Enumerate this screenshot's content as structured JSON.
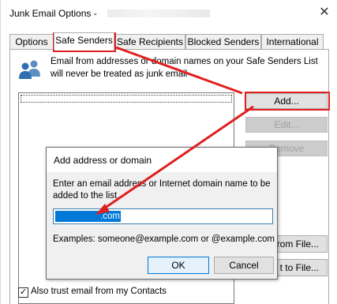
{
  "window": {
    "title": "Junk Email Options - ",
    "close_glyph": "✕"
  },
  "tabs": [
    {
      "label": "Options"
    },
    {
      "label": "Safe Senders"
    },
    {
      "label": "Safe Recipients"
    },
    {
      "label": "Blocked Senders"
    },
    {
      "label": "International"
    }
  ],
  "safe_senders": {
    "description": "Email from addresses or domain names on your Safe Senders List will never be treated as junk email",
    "buttons": {
      "add": "Add...",
      "edit": "Edit...",
      "remove": "Remove",
      "import": "from File...",
      "export": "t to File..."
    },
    "trust_contacts_label": "Also trust email from my Contacts",
    "trust_contacts_checked": true
  },
  "add_dialog": {
    "title": "Add address or domain",
    "prompt": "Enter an email address or Internet domain name to be added to the list.",
    "input_value": ".com",
    "examples": "Examples: someone@example.com or @example.com",
    "ok_label": "OK",
    "cancel_label": "Cancel"
  },
  "colors": {
    "highlight": "#e02020",
    "selection": "#0078d7"
  }
}
